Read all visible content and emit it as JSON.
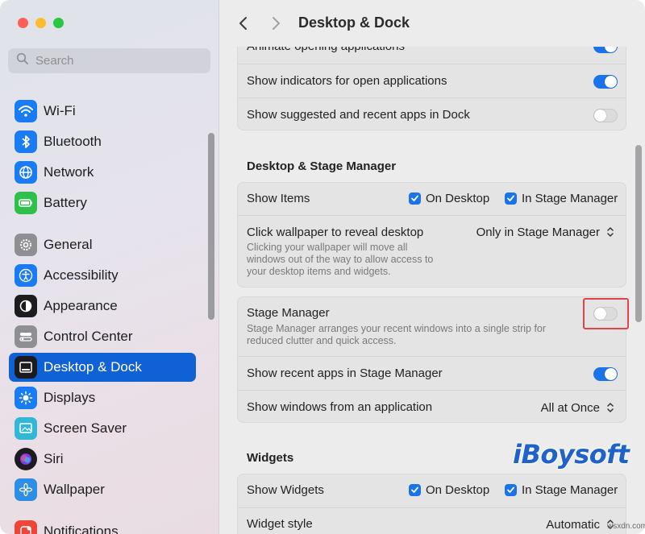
{
  "sidebar": {
    "search_placeholder": "Search",
    "items": [
      {
        "label": "Wi-Fi",
        "icon": "wifi-icon",
        "color": "#1a7cf5"
      },
      {
        "label": "Bluetooth",
        "icon": "bluetooth-icon",
        "color": "#1a7cf5"
      },
      {
        "label": "Network",
        "icon": "globe-icon",
        "color": "#1a7cf5"
      },
      {
        "label": "Battery",
        "icon": "battery-icon",
        "color": "#2fbf4a"
      },
      {
        "label": "General",
        "icon": "gear-icon",
        "color": "#8e8e93"
      },
      {
        "label": "Accessibility",
        "icon": "accessibility-icon",
        "color": "#1a7cf5"
      },
      {
        "label": "Appearance",
        "icon": "appearance-icon",
        "color": "#1c1c1e"
      },
      {
        "label": "Control Center",
        "icon": "control-center-icon",
        "color": "#8e8e93"
      },
      {
        "label": "Desktop & Dock",
        "icon": "desktop-dock-icon",
        "color": "#1c1c1e",
        "selected": true
      },
      {
        "label": "Displays",
        "icon": "sun-icon",
        "color": "#1a7cf5"
      },
      {
        "label": "Screen Saver",
        "icon": "screen-saver-icon",
        "color": "#33b7d6"
      },
      {
        "label": "Siri",
        "icon": "siri-icon",
        "color": "#7b3fe4"
      },
      {
        "label": "Wallpaper",
        "icon": "flower-icon",
        "color": "#2f8de4"
      },
      {
        "label": "Notifications",
        "icon": "notifications-icon",
        "color": "#f0463a"
      }
    ]
  },
  "toolbar": {
    "title": "Desktop & Dock"
  },
  "dock_group": {
    "animate_label": "Animate opening applications",
    "indicators_label": "Show indicators for open applications",
    "suggested_label": "Show suggested and recent apps in Dock"
  },
  "desktop_stage": {
    "section_title": "Desktop & Stage Manager",
    "show_items_label": "Show Items",
    "on_desktop": "On Desktop",
    "in_stage_manager": "In Stage Manager",
    "click_wallpaper_label": "Click wallpaper to reveal desktop",
    "click_wallpaper_value": "Only in Stage Manager",
    "click_wallpaper_desc1": "Clicking your wallpaper will move all",
    "click_wallpaper_desc2": "windows out of the way to allow access to",
    "click_wallpaper_desc3": "your desktop items and widgets."
  },
  "stage_manager": {
    "label": "Stage Manager",
    "desc1": "Stage Manager arranges your recent windows into a single strip for",
    "desc2": "reduced clutter and quick access.",
    "recent_apps_label": "Show recent apps in Stage Manager",
    "windows_label": "Show windows from an application",
    "windows_value": "All at Once"
  },
  "widgets": {
    "section_title": "Widgets",
    "show_widgets_label": "Show Widgets",
    "on_desktop": "On Desktop",
    "in_stage_manager": "In Stage Manager",
    "style_label": "Widget style",
    "style_value": "Automatic"
  },
  "watermark": "iBoysoft",
  "footnote": "wsxdn.com",
  "colors": {
    "accent": "#1a73e8",
    "selected": "#1060d6",
    "highlight": "#e0434a"
  }
}
